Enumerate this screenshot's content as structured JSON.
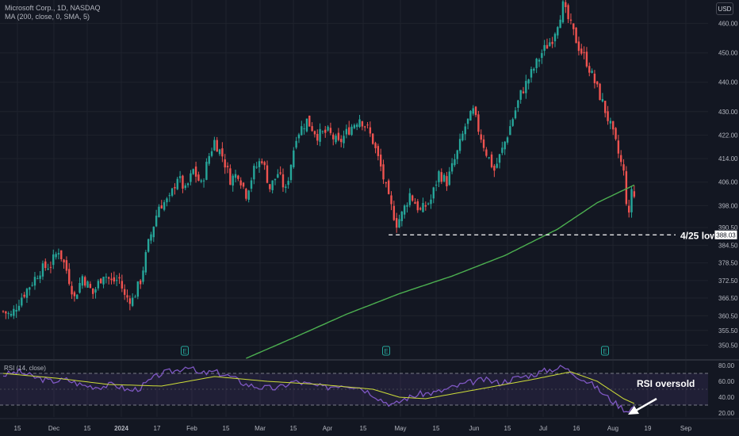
{
  "header": {
    "symbol_line": "Microsoft Corp., 1D, NASDAQ",
    "indicator_line": "MA (200, close, 0, SMA, 5)",
    "currency_button": "USD"
  },
  "rsi_panel": {
    "legend": "RSI (14, close)",
    "ticks": [
      "80.00",
      "60.00",
      "40.00",
      "20.00"
    ],
    "annotation": "RSI oversold"
  },
  "chart_data": {
    "type": "candlestick",
    "ylim": [
      346,
      468
    ],
    "price_ticks": [
      "460.00",
      "450.00",
      "440.00",
      "430.00",
      "422.00",
      "414.00",
      "406.00",
      "398.00",
      "390.50",
      "384.50",
      "378.50",
      "372.50",
      "366.50",
      "360.50",
      "355.50",
      "350.50"
    ],
    "price_tick_values": [
      460,
      450,
      440,
      430,
      422,
      414,
      406,
      398,
      390.5,
      384.5,
      378.5,
      372.5,
      366.5,
      360.5,
      355.5,
      350.5
    ],
    "last_price_label": "388.03",
    "last_price_value": 388.03,
    "support_line": {
      "label": "4/25 low",
      "value": 388.03
    },
    "x_ticks": [
      "15",
      "Dec",
      "15",
      "2024",
      "17",
      "Feb",
      "15",
      "Mar",
      "15",
      "Apr",
      "15",
      "May",
      "15",
      "Jun",
      "15",
      "Jul",
      "16",
      "Aug",
      "19",
      "Sep"
    ],
    "price_anchors": [
      [
        0,
        362
      ],
      [
        3,
        360.5
      ],
      [
        7,
        367
      ],
      [
        11,
        372
      ],
      [
        14,
        376
      ],
      [
        18,
        378
      ],
      [
        21,
        383
      ],
      [
        24,
        376
      ],
      [
        27,
        366.5
      ],
      [
        30,
        374
      ],
      [
        34,
        368
      ],
      [
        38,
        375
      ],
      [
        41,
        372
      ],
      [
        44,
        373
      ],
      [
        46,
        367
      ],
      [
        49,
        366
      ],
      [
        52,
        372.5
      ],
      [
        55,
        385
      ],
      [
        59,
        398
      ],
      [
        63,
        400
      ],
      [
        66,
        408
      ],
      [
        69,
        403
      ],
      [
        72,
        410
      ],
      [
        75,
        405
      ],
      [
        78,
        415
      ],
      [
        80,
        420
      ],
      [
        83,
        415
      ],
      [
        86,
        407
      ],
      [
        89,
        409
      ],
      [
        92,
        402
      ],
      [
        95,
        410
      ],
      [
        98,
        414
      ],
      [
        101,
        404
      ],
      [
        104,
        409
      ],
      [
        107,
        403
      ],
      [
        111,
        422
      ],
      [
        115,
        427
      ],
      [
        119,
        422
      ],
      [
        123,
        423
      ],
      [
        127,
        419
      ],
      [
        131,
        424
      ],
      [
        135,
        428
      ],
      [
        138,
        424
      ],
      [
        140,
        420
      ],
      [
        143,
        411
      ],
      [
        146,
        400
      ],
      [
        149,
        392
      ],
      [
        151,
        395
      ],
      [
        154,
        402
      ],
      [
        158,
        396
      ],
      [
        162,
        400
      ],
      [
        165,
        409
      ],
      [
        168,
        406
      ],
      [
        172,
        416
      ],
      [
        175,
        425
      ],
      [
        178,
        430
      ],
      [
        180,
        424
      ],
      [
        183,
        416
      ],
      [
        186,
        410
      ],
      [
        189,
        417
      ],
      [
        192,
        425
      ],
      [
        196,
        436
      ],
      [
        200,
        443
      ],
      [
        204,
        450
      ],
      [
        208,
        455
      ],
      [
        212,
        466
      ],
      [
        215,
        459
      ],
      [
        218,
        452
      ],
      [
        221,
        447
      ],
      [
        224,
        440
      ],
      [
        227,
        433
      ],
      [
        230,
        425
      ],
      [
        232,
        419
      ],
      [
        235,
        409
      ],
      [
        236,
        400
      ],
      [
        237,
        394
      ],
      [
        238,
        404
      ],
      [
        239,
        401
      ]
    ],
    "earnings_markers": [
      "E",
      "E",
      "E"
    ],
    "series": [
      {
        "name": "MA (200, close, 0, SMA, 5)",
        "color": "#4caf50",
        "points": [
          [
            92,
            346
          ],
          [
            110,
            353
          ],
          [
            130,
            361
          ],
          [
            150,
            368
          ],
          [
            170,
            374
          ],
          [
            190,
            381
          ],
          [
            210,
            390
          ],
          [
            225,
            399
          ],
          [
            239,
            405
          ]
        ]
      }
    ],
    "rsi": {
      "ylim": [
        15,
        85
      ],
      "upper": 70,
      "lower": 30,
      "color": "#7e57c2",
      "ma_color": "#cddc39",
      "anchors": [
        [
          0,
          68
        ],
        [
          6,
          72
        ],
        [
          12,
          65
        ],
        [
          18,
          60
        ],
        [
          24,
          62
        ],
        [
          30,
          55
        ],
        [
          36,
          53
        ],
        [
          42,
          56
        ],
        [
          48,
          48
        ],
        [
          52,
          52
        ],
        [
          56,
          62
        ],
        [
          60,
          70
        ],
        [
          66,
          74
        ],
        [
          70,
          80
        ],
        [
          74,
          69
        ],
        [
          80,
          72
        ],
        [
          86,
          66
        ],
        [
          92,
          56
        ],
        [
          98,
          52
        ],
        [
          104,
          51
        ],
        [
          110,
          60
        ],
        [
          116,
          56
        ],
        [
          122,
          52
        ],
        [
          128,
          56
        ],
        [
          134,
          54
        ],
        [
          140,
          44
        ],
        [
          144,
          35
        ],
        [
          148,
          30
        ],
        [
          152,
          38
        ],
        [
          158,
          44
        ],
        [
          164,
          46
        ],
        [
          170,
          52
        ],
        [
          176,
          58
        ],
        [
          182,
          62
        ],
        [
          188,
          58
        ],
        [
          194,
          64
        ],
        [
          200,
          68
        ],
        [
          206,
          74
        ],
        [
          212,
          78
        ],
        [
          216,
          70
        ],
        [
          220,
          62
        ],
        [
          224,
          54
        ],
        [
          228,
          42
        ],
        [
          232,
          32
        ],
        [
          236,
          23
        ],
        [
          239,
          28
        ]
      ],
      "ma_anchors": [
        [
          0,
          70
        ],
        [
          20,
          64
        ],
        [
          40,
          56
        ],
        [
          60,
          54
        ],
        [
          80,
          66
        ],
        [
          100,
          60
        ],
        [
          120,
          56
        ],
        [
          140,
          50
        ],
        [
          150,
          40
        ],
        [
          160,
          38
        ],
        [
          180,
          50
        ],
        [
          200,
          62
        ],
        [
          215,
          72
        ],
        [
          225,
          60
        ],
        [
          235,
          38
        ],
        [
          239,
          32
        ]
      ]
    }
  },
  "palette": {
    "background": "#131722",
    "grid": "#1f232d",
    "up": "#26a69a",
    "down": "#ef5350",
    "axis_text": "#b2b5be",
    "white": "#ffffff"
  }
}
